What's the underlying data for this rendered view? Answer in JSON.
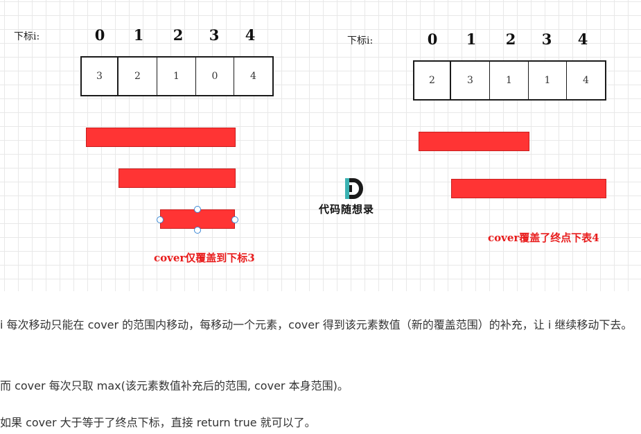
{
  "left_diagram": {
    "index_label": "下标i:",
    "indices": [
      "0",
      "1",
      "2",
      "3",
      "4"
    ],
    "values": [
      "3",
      "2",
      "1",
      "0",
      "4"
    ],
    "caption": "cover仅覆盖到下标3"
  },
  "right_diagram": {
    "index_label": "下标i:",
    "indices": [
      "0",
      "1",
      "2",
      "3",
      "4"
    ],
    "values": [
      "2",
      "3",
      "1",
      "1",
      "4"
    ],
    "caption": "cover覆盖了终点下表4"
  },
  "watermark": {
    "logo_letter": "D",
    "text": "代码随想录"
  },
  "paragraphs": [
    "i 每次移动只能在 cover 的范围内移动，每移动一个元素，cover 得到该元素数值（新的覆盖范围）的补充，让 i 继续移动下去。",
    "而 cover 每次只取 max(该元素数值补充后的范围, cover 本身范围)。",
    "如果 cover 大于等于了终点下标，直接 return true 就可以了。"
  ],
  "colors": {
    "bar_fill": "#ff3434",
    "caption_red": "#e81c1c",
    "handle_blue": "#3a87d6",
    "logo_teal": "#3bb3b3"
  }
}
